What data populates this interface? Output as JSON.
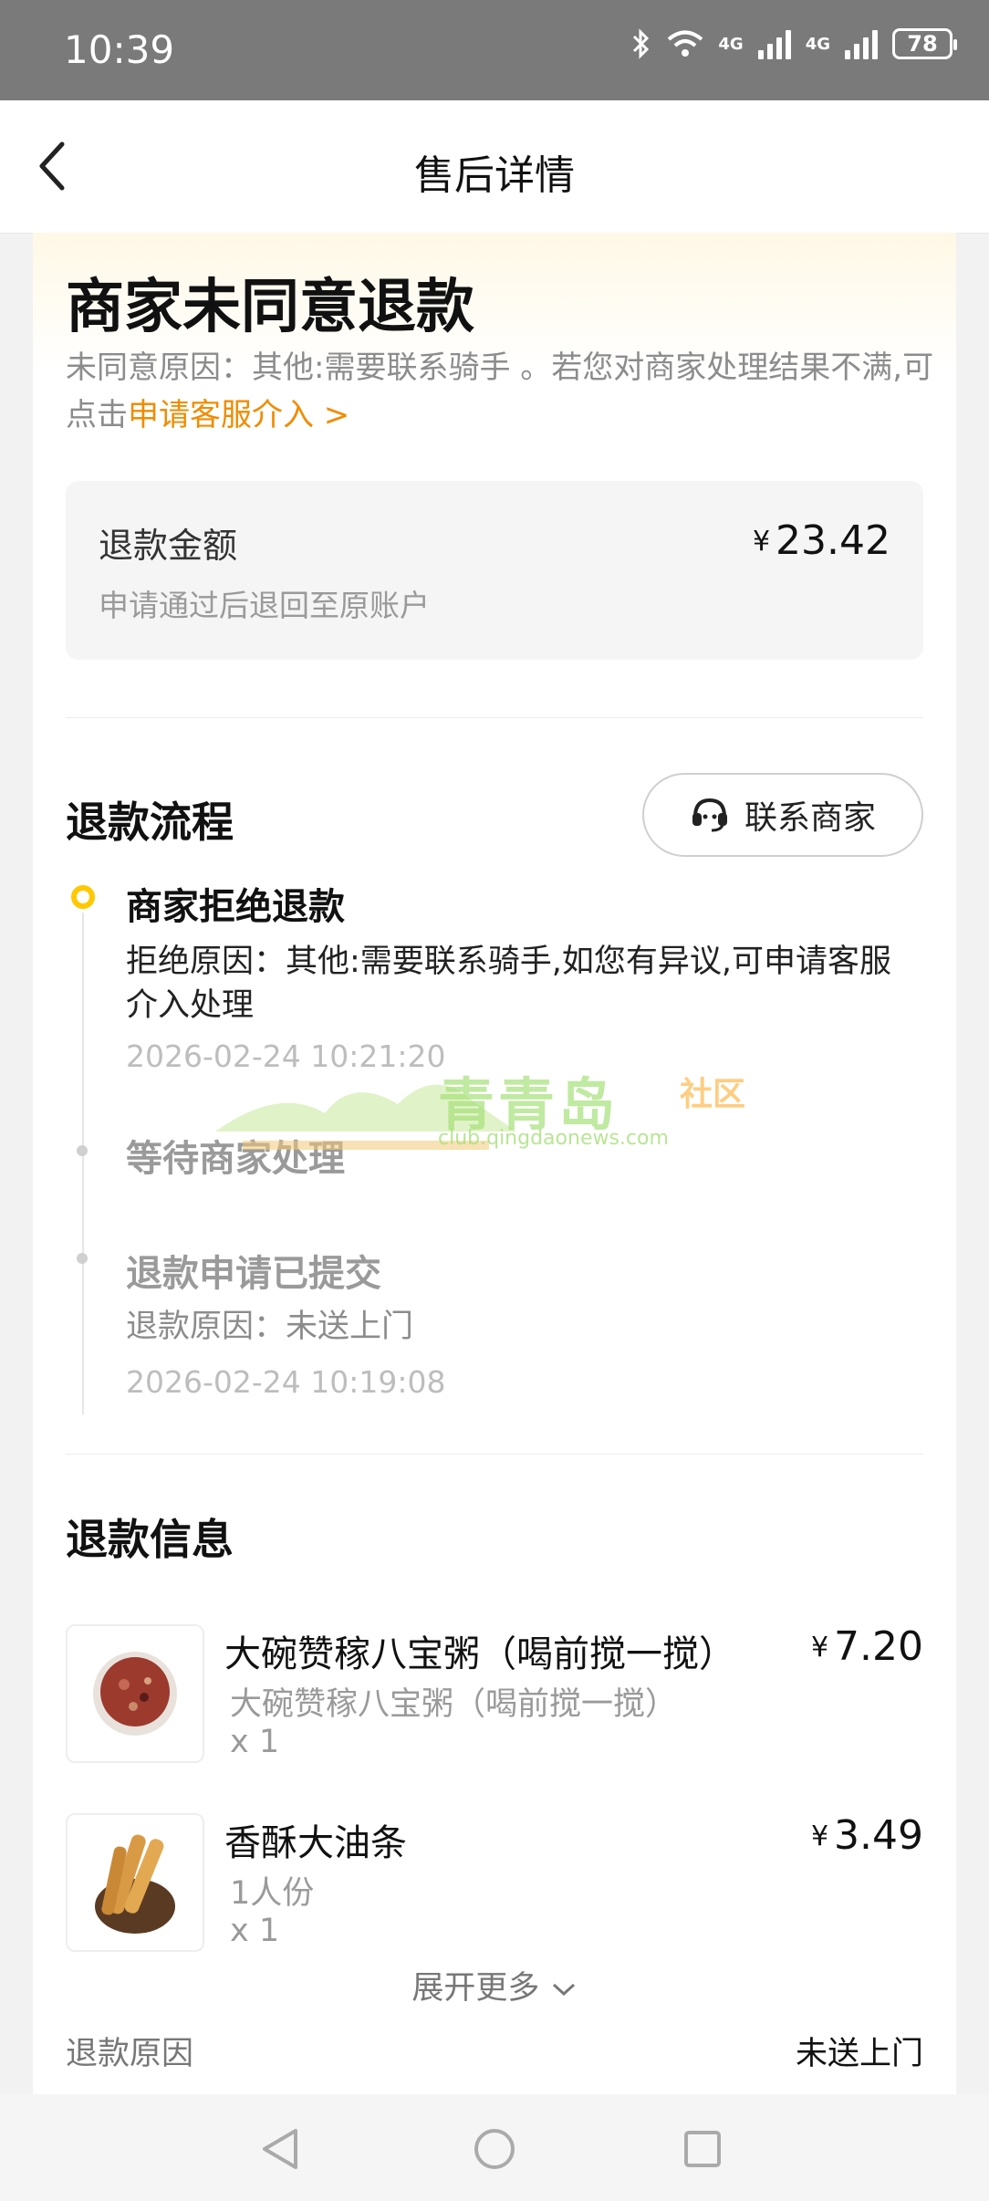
{
  "status_bar": {
    "time": "10:39",
    "network1": "4G",
    "network2": "4G",
    "battery": "78"
  },
  "nav": {
    "title": "售后详情"
  },
  "status": {
    "headline": "商家未同意退款",
    "reason_text": "未同意原因：其他:需要联系骑手 。若您对商家处理结果不满,可点击",
    "reason_link": "申请客服介入 >"
  },
  "refund_amount": {
    "label": "退款金额",
    "note": "申请通过后退回至原账户",
    "currency": "¥",
    "value": "23.42"
  },
  "process": {
    "title": "退款流程",
    "contact_label": "联系商家",
    "steps": [
      {
        "title": "商家拒绝退款",
        "text": "拒绝原因：其他:需要联系骑手,如您有异议,可申请客服介入处理",
        "time": "2026-02-24 10:21:20"
      },
      {
        "title": "等待商家处理"
      },
      {
        "title": "退款申请已提交",
        "text": "退款原因：未送上门",
        "time": "2026-02-24 10:19:08"
      }
    ]
  },
  "refund_info": {
    "title": "退款信息",
    "items": [
      {
        "name": "大碗赞稼八宝粥（喝前搅一搅）",
        "spec": "大碗赞稼八宝粥（喝前搅一搅）",
        "qty": "x 1",
        "currency": "¥",
        "price": "7.20"
      },
      {
        "name": "香酥大油条",
        "spec": "1人份",
        "qty": "x 1",
        "currency": "¥",
        "price": "3.49"
      }
    ],
    "expand_label": "展开更多",
    "reason_label": "退款原因",
    "reason_value": "未送上门"
  },
  "watermark": {
    "name": "青青岛",
    "tag": "社区",
    "url": "club.qingdaonews.com"
  },
  "colors": {
    "accent": "#ffc800",
    "link": "#f08c00"
  }
}
